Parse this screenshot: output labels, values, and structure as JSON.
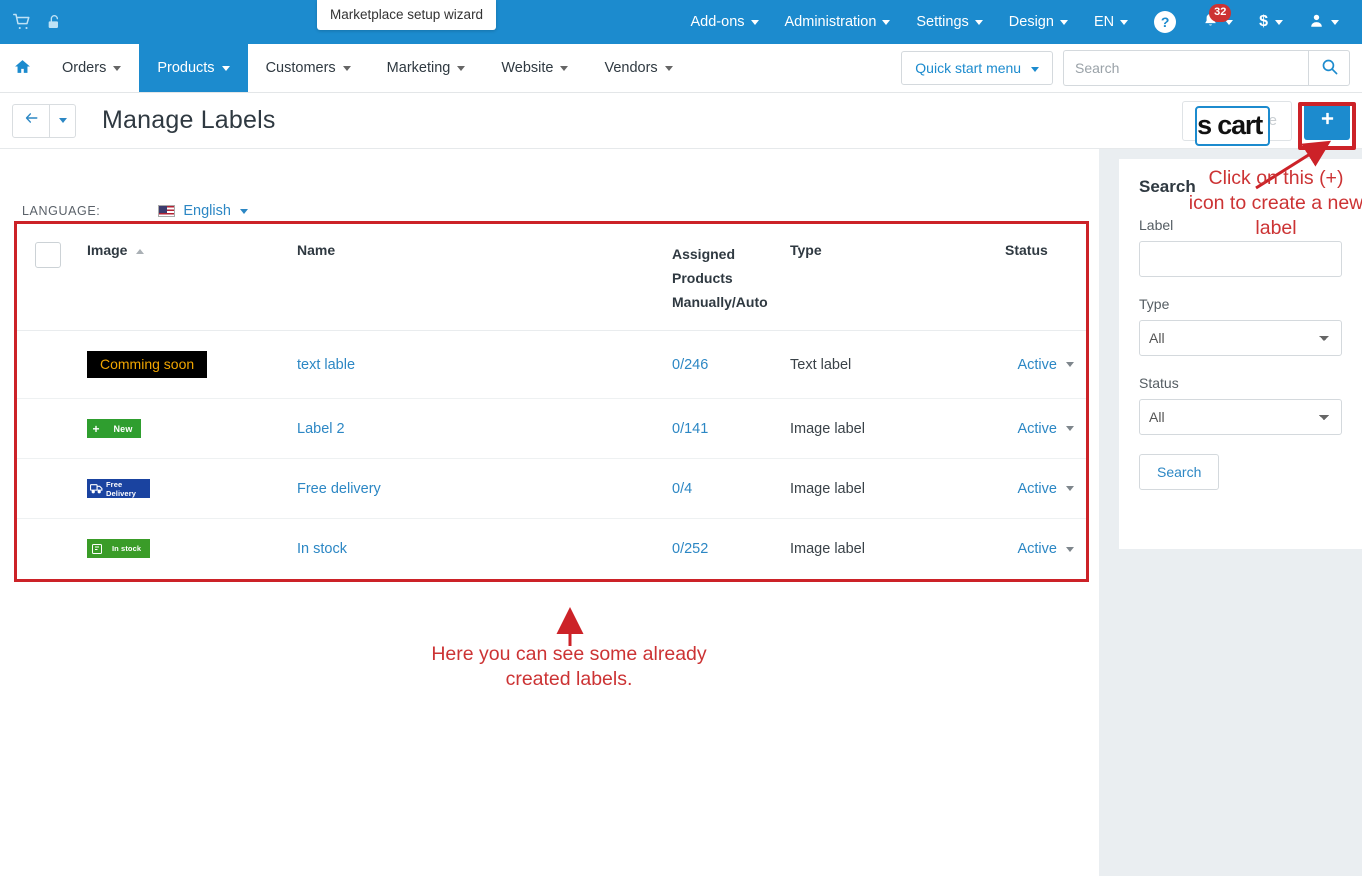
{
  "topbar": {
    "icons": [
      {
        "name": "cart-icon",
        "glyph": "cart"
      },
      {
        "name": "unlock-icon",
        "glyph": "unlock"
      }
    ],
    "wizard_tip": "Marketplace setup wizard",
    "menus": [
      {
        "label": "Add-ons"
      },
      {
        "label": "Administration"
      },
      {
        "label": "Settings"
      },
      {
        "label": "Design"
      },
      {
        "label": "EN"
      }
    ],
    "help_label": "?",
    "notifications_count": "32",
    "currency_symbol": "$"
  },
  "mainnav": {
    "home_icon": "home-icon",
    "items": [
      {
        "label": "Orders",
        "active": false
      },
      {
        "label": "Products",
        "active": true
      },
      {
        "label": "Customers",
        "active": false
      },
      {
        "label": "Marketing",
        "active": false
      },
      {
        "label": "Website",
        "active": false
      },
      {
        "label": "Vendors",
        "active": false
      }
    ],
    "quick_start_label": "Quick start menu",
    "search_placeholder": "Search",
    "search_value": ""
  },
  "titlebar": {
    "title": "Manage Labels",
    "demo_store_label": "Demo Store",
    "logo_text": "s cart",
    "add_label": "+"
  },
  "language": {
    "label": "LANGUAGE:",
    "current": "English"
  },
  "table": {
    "columns": {
      "image": "Image",
      "name": "Name",
      "assigned": "Assigned Products Manually/Auto",
      "assigned_line1": "Assigned",
      "assigned_line2": "Products",
      "assigned_line3": "Manually/Auto",
      "type": "Type",
      "status": "Status"
    },
    "rows": [
      {
        "badge_style": "coming",
        "badge_text": "Comming soon",
        "name": "text lable",
        "assigned": "0/246",
        "type": "Text label",
        "status": "Active"
      },
      {
        "badge_style": "new",
        "badge_text": "New",
        "name": "Label 2",
        "assigned": "0/141",
        "type": "Image label",
        "status": "Active"
      },
      {
        "badge_style": "free",
        "badge_text": "Free Delivery",
        "name": "Free delivery",
        "assigned": "0/4",
        "type": "Image label",
        "status": "Active"
      },
      {
        "badge_style": "instock",
        "badge_text": "In stock",
        "name": "In stock",
        "assigned": "0/252",
        "type": "Image label",
        "status": "Active"
      }
    ]
  },
  "sidepanel": {
    "heading": "Search",
    "label_field_label": "Label",
    "label_field_value": "",
    "type_field_label": "Type",
    "type_selected": "All",
    "type_options": [
      "All"
    ],
    "status_field_label": "Status",
    "status_selected": "All",
    "status_options": [
      "All"
    ],
    "search_button": "Search"
  },
  "annotations": {
    "top_right": "Click on this (+) icon to create a new label",
    "bottom": "Here you can see some already created labels.",
    "color": "#cc3334"
  },
  "colors": {
    "brand_blue": "#1c8bce",
    "link_blue": "#2c87c4",
    "annotation_red": "#cc3334",
    "badge_red": "#cc3333",
    "panel_bg": "#eaeef1"
  }
}
